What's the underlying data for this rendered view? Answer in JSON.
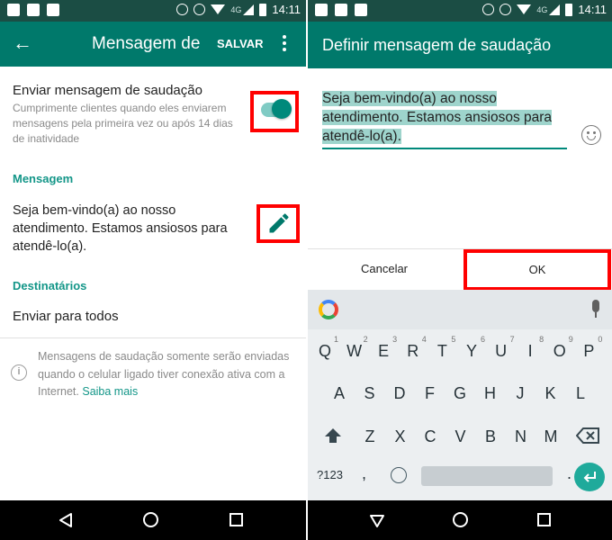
{
  "status_bar": {
    "time": "14:11",
    "network": "4G"
  },
  "left_screen": {
    "app_bar": {
      "back_icon": "arrow-left-icon",
      "title": "Mensagem de",
      "save_label": "SALVAR",
      "menu_icon": "more-vert-icon"
    },
    "greeting_setting": {
      "title": "Enviar mensagem de saudação",
      "subtitle": "Cumprimente clientes quando eles enviarem mensagens pela primeira vez ou após 14 dias de inatividade",
      "enabled": true
    },
    "message_section": {
      "label": "Mensagem",
      "text": "Seja bem-vindo(a) ao nosso atendimento. Estamos ansiosos para atendê-lo(a).",
      "edit_icon": "pencil-icon"
    },
    "recipients_section": {
      "label": "Destinatários",
      "value": "Enviar para todos"
    },
    "info": {
      "icon": "info-icon",
      "text": "Mensagens de saudação somente serão enviadas quando o celular ligado tiver conexão ativa com a Internet.",
      "link": "Saiba mais"
    }
  },
  "right_screen": {
    "dialog": {
      "title": "Definir mensagem de saudação",
      "input_value": "Seja bem-vindo(a) ao nosso atendimento. Estamos ansiosos para atendê-lo(a).",
      "emoji_icon": "smiley-icon",
      "cancel_label": "Cancelar",
      "ok_label": "OK"
    },
    "keyboard": {
      "row1": [
        {
          "key": "Q",
          "hint": "1"
        },
        {
          "key": "W",
          "hint": "2"
        },
        {
          "key": "E",
          "hint": "3"
        },
        {
          "key": "R",
          "hint": "4"
        },
        {
          "key": "T",
          "hint": "5"
        },
        {
          "key": "Y",
          "hint": "6"
        },
        {
          "key": "U",
          "hint": "7"
        },
        {
          "key": "I",
          "hint": "8"
        },
        {
          "key": "O",
          "hint": "9"
        },
        {
          "key": "P",
          "hint": "0"
        }
      ],
      "row2": [
        "A",
        "S",
        "D",
        "F",
        "G",
        "H",
        "J",
        "K",
        "L"
      ],
      "row3": [
        "Z",
        "X",
        "C",
        "V",
        "B",
        "N",
        "M"
      ],
      "symbols_label": "?123",
      "comma": ",",
      "period": "."
    }
  },
  "colors": {
    "primary": "#00796b",
    "status_bar": "#1b4d44",
    "accent": "#00897b",
    "highlight_box": "#ff0000",
    "selection": "#9ed4cc"
  }
}
